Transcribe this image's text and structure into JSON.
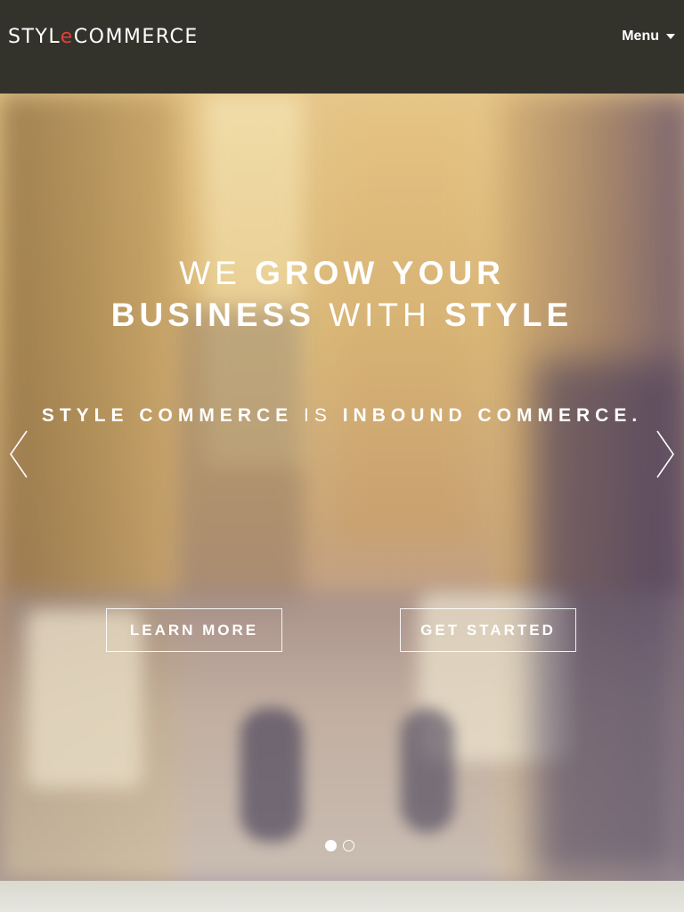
{
  "header": {
    "logo_prefix": "STYL",
    "logo_accent": "e",
    "logo_suffix": "COMMERCE",
    "menu_label": "Menu"
  },
  "hero": {
    "headline_line1_thin": "WE",
    "headline_line1_bold": "GROW YOUR",
    "headline_line2_bold_a": "BUSINESS",
    "headline_line2_thin": "WITH",
    "headline_line2_bold_b": "STYLE",
    "sub_bold_a": "STYLE COMMERCE",
    "sub_thin": "IS",
    "sub_bold_b": "INBOUND COMMERCE.",
    "learn_more_label": "LEARN MORE",
    "get_started_label": "GET STARTED",
    "slide_count": 2,
    "active_slide": 1
  },
  "colors": {
    "header_bg": "#33332c",
    "logo_accent": "#e0403a",
    "text": "#ffffff"
  },
  "icons": {
    "prev": "chevron-left-icon",
    "next": "chevron-right-icon",
    "menu_caret": "caret-down-icon"
  }
}
